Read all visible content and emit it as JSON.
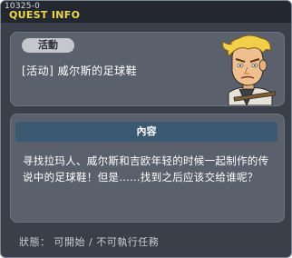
{
  "window": {
    "quest_id": "10325-0",
    "title": "QUEST INFO"
  },
  "quest": {
    "category": "活動",
    "name": "[活动] 威尔斯的足球鞋"
  },
  "content": {
    "header": "內容",
    "description": "寻找拉玛人、威尔斯和吉欧年轻的时候一起制作的传说中的足球鞋！但是……找到之后应该交给谁呢？"
  },
  "status": {
    "text": "狀態： 可開始 / 不可執行任務"
  },
  "icons": {
    "npc": "npc-portrait-icon"
  }
}
